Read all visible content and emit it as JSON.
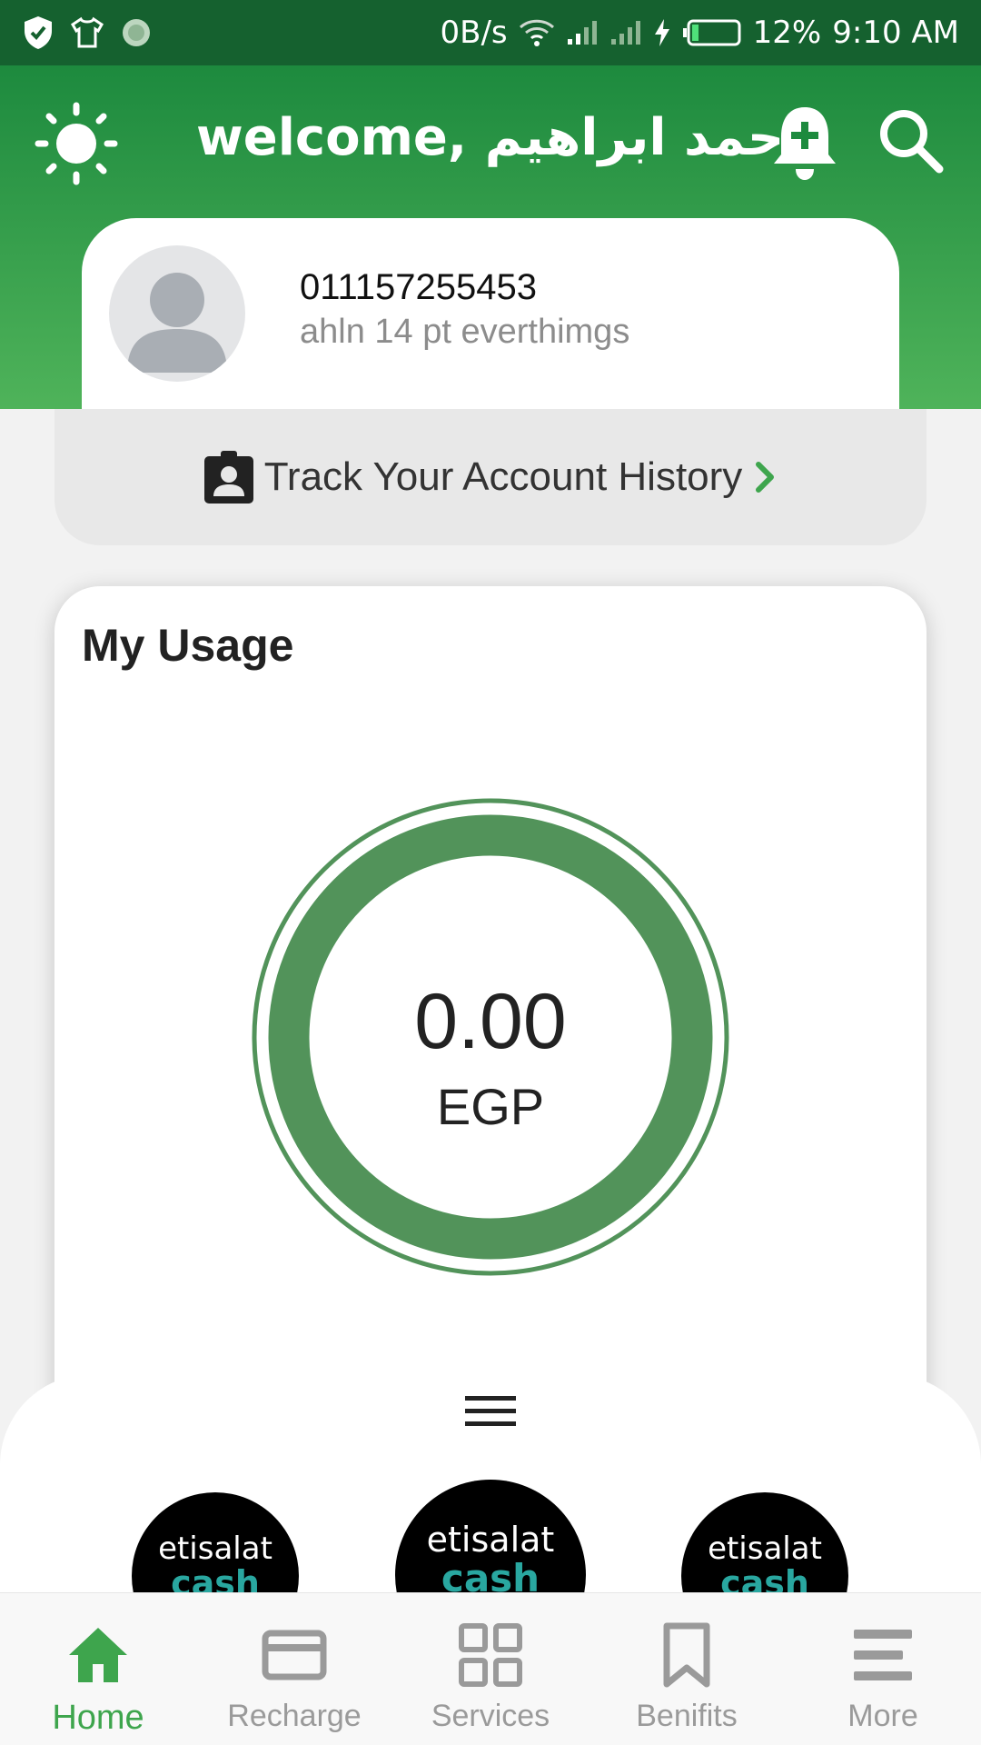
{
  "status_bar": {
    "net_speed": "0B/s",
    "battery": "12%",
    "time": "9:10 AM"
  },
  "header": {
    "welcome": "welcome, احمد ابراهيم"
  },
  "profile": {
    "phone": "011157255453",
    "plan": "ahln 14 pt everthimgs"
  },
  "track": {
    "label": "Track Your Account History"
  },
  "usage": {
    "title": "My Usage",
    "amount": "0.00",
    "currency": "EGP"
  },
  "cash_logos": [
    {
      "brand": "etisalat",
      "sub": "cash"
    },
    {
      "brand": "etisalat",
      "sub": "cash"
    },
    {
      "brand": "etisalat",
      "sub": "cash"
    }
  ],
  "nav": [
    {
      "label": "Home"
    },
    {
      "label": "Recharge"
    },
    {
      "label": "Services"
    },
    {
      "label": "Benifits"
    },
    {
      "label": "More"
    }
  ],
  "colors": {
    "primary_green": "#1d8a3e",
    "ring_green": "#52935a",
    "active_nav": "#3ea54d"
  }
}
